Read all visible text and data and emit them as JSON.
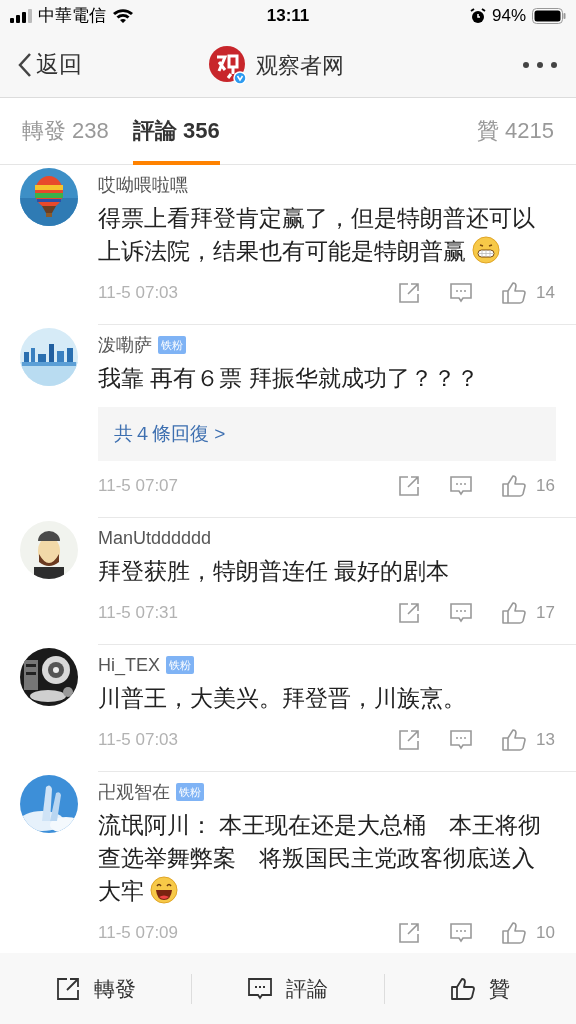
{
  "status_bar": {
    "carrier": "中華電信",
    "time": "13:11",
    "battery": "94%"
  },
  "nav": {
    "back": "返回",
    "title": "观察者网"
  },
  "tabs": [
    {
      "label": "轉發 238",
      "selected": false
    },
    {
      "label": "評論 356",
      "selected": true
    },
    {
      "label": "贊 4215",
      "selected": false
    }
  ],
  "comments": [
    {
      "name": "哎呦喂啦嘿",
      "text": "得票上看拜登肯定赢了，但是特朗普还可以上诉法院，结果也有可能是特朗普赢",
      "emoji": true,
      "time": "11-5 07:03",
      "likes": "14"
    },
    {
      "name": "泼嘞萨",
      "badge": "铁粉",
      "text": "我靠  再有６票 拜振华就成功了？？？",
      "replies": "共４條回復 >",
      "time": "11-5 07:07",
      "likes": "16"
    },
    {
      "name": "ManUtdddddd",
      "text": "拜登获胜，特朗普连任 最好的剧本",
      "time": "11-5 07:31",
      "likes": "17"
    },
    {
      "name": "Hi_TEX",
      "badge": "铁粉",
      "text": "川普王，大美兴。拜登晋，川族烹。",
      "time": "11-5 07:03",
      "likes": "13"
    },
    {
      "name": "卍观智在",
      "badge": "铁粉",
      "text": "流氓阿川： 本王现在还是大总桶　本王将彻查选举舞弊案　将叛国民主党政客彻底送入大牢",
      "emoji": true,
      "time": "11-5 07:09",
      "likes": "10"
    }
  ],
  "bottom_bar": [
    {
      "kind": "repost",
      "label": "轉發"
    },
    {
      "kind": "comment",
      "label": "評論"
    },
    {
      "kind": "like",
      "label": "贊"
    }
  ]
}
